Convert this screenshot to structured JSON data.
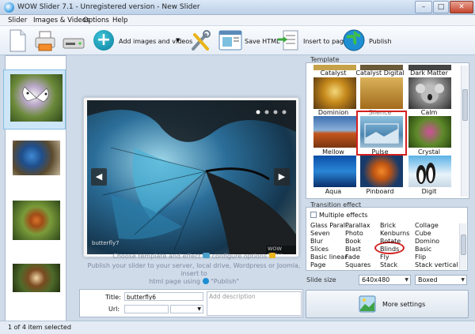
{
  "window": {
    "title": "WOW Slider 7.1 - Unregistered version - New Slider",
    "min": "–",
    "max": "□",
    "close": "✕"
  },
  "menu": [
    "Slider",
    "Images & Videos",
    "Options",
    "Help"
  ],
  "toolbar": {
    "add_images": "Add images and videos",
    "save_html": "Save HTML",
    "insert_to_page": "Insert to page",
    "publish": "Publish"
  },
  "slides_panel": {
    "add": "+",
    "remove": "−"
  },
  "preview": {
    "caption": "butterfly7",
    "watermark": "WOW Slider",
    "prev": "◀",
    "next": "▶"
  },
  "hints": {
    "line1": "Choose template and effect",
    "line1b": "configure options",
    "line2": "Publish your slider to your server, local drive, Wordpress or Joomla, insert to",
    "line3": "html page using",
    "line3b": "\"Publish\""
  },
  "form": {
    "title_label": "Title:",
    "title_value": "butterfly6",
    "url_label": "Url:",
    "url_value": "",
    "desc_placeholder": "Add description"
  },
  "template": {
    "section_label": "Template",
    "items": [
      {
        "label": "Catalyst"
      },
      {
        "label": "Catalyst Digital"
      },
      {
        "label": "Dark Matter"
      },
      {
        "label": "Dominion"
      },
      {
        "label": "Silence"
      },
      {
        "label": "Calm"
      },
      {
        "label": "Mellow"
      },
      {
        "label": "Pulse"
      },
      {
        "label": "Crystal"
      },
      {
        "label": "Aqua"
      },
      {
        "label": "Pinboard"
      },
      {
        "label": "Digit"
      }
    ],
    "selected": "Pulse"
  },
  "transition": {
    "section_label": "Transition effect",
    "multiple_effects": "Multiple effects",
    "col1": [
      "Glass Parall...",
      "Seven",
      "Blur",
      "Slices",
      "Basic linear",
      "Page"
    ],
    "col2": [
      "Parallax",
      "Photo",
      "Book",
      "Blast",
      "Fade",
      "Squares"
    ],
    "col3": [
      "Brick",
      "Kenburns",
      "Rotate",
      "Blinds",
      "Fly",
      "Stack"
    ],
    "col4": [
      "Collage",
      "Cube",
      "Domino",
      "Basic",
      "Flip",
      "Stack vertical"
    ],
    "selected": "Blinds"
  },
  "slide_size": {
    "label": "Slide size",
    "value": "640x480",
    "mode": "Boxed"
  },
  "more_settings": "More settings",
  "status": "1 of 4 item selected"
}
